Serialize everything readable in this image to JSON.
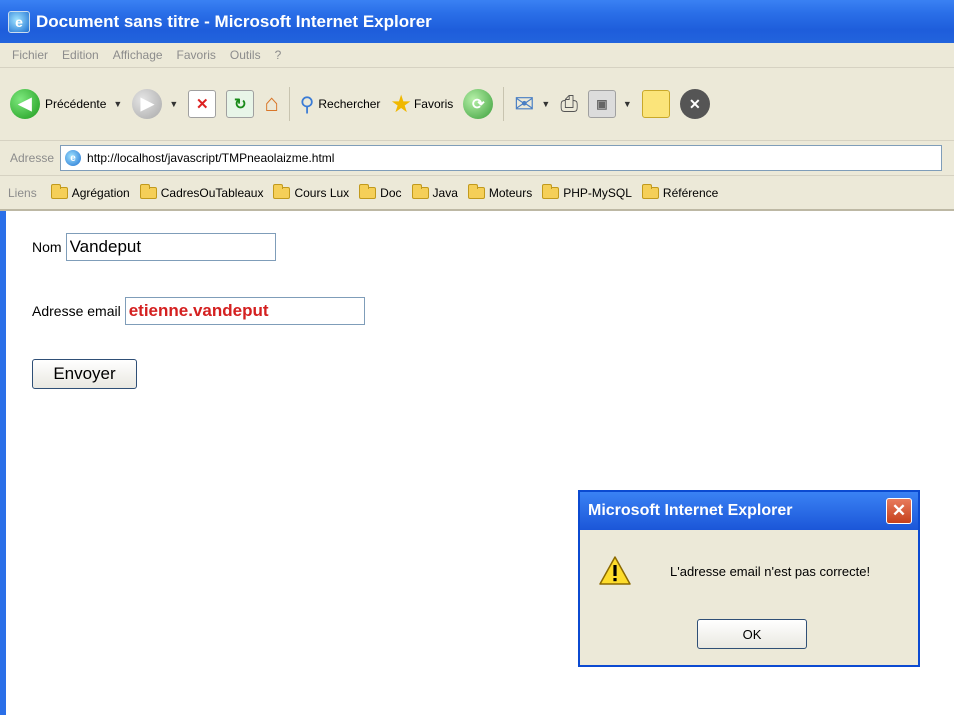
{
  "window": {
    "title": "Document sans titre - Microsoft Internet Explorer"
  },
  "menu": [
    "Fichier",
    "Edition",
    "Affichage",
    "Favoris",
    "Outils",
    "?"
  ],
  "toolbar": {
    "back_label": "Précédente",
    "search_label": "Rechercher",
    "favorites_label": "Favoris"
  },
  "address": {
    "label": "Adresse",
    "url": "http://localhost/javascript/TMPneaolaizme.html"
  },
  "links": {
    "label": "Liens",
    "items": [
      "Agrégation",
      "CadresOuTableaux",
      "Cours Lux",
      "Doc",
      "Java",
      "Moteurs",
      "PHP-MySQL",
      "Référence"
    ]
  },
  "form": {
    "name_label": "Nom",
    "name_value": "Vandeput",
    "email_label": "Adresse email",
    "email_value": "etienne.vandeput",
    "submit_label": "Envoyer"
  },
  "dialog": {
    "title": "Microsoft Internet Explorer",
    "message": "L'adresse email n'est pas correcte!",
    "ok_label": "OK"
  },
  "colors": {
    "titlebar": "#2a6fe8",
    "chrome": "#ece9d8",
    "email_text": "#d42020"
  }
}
